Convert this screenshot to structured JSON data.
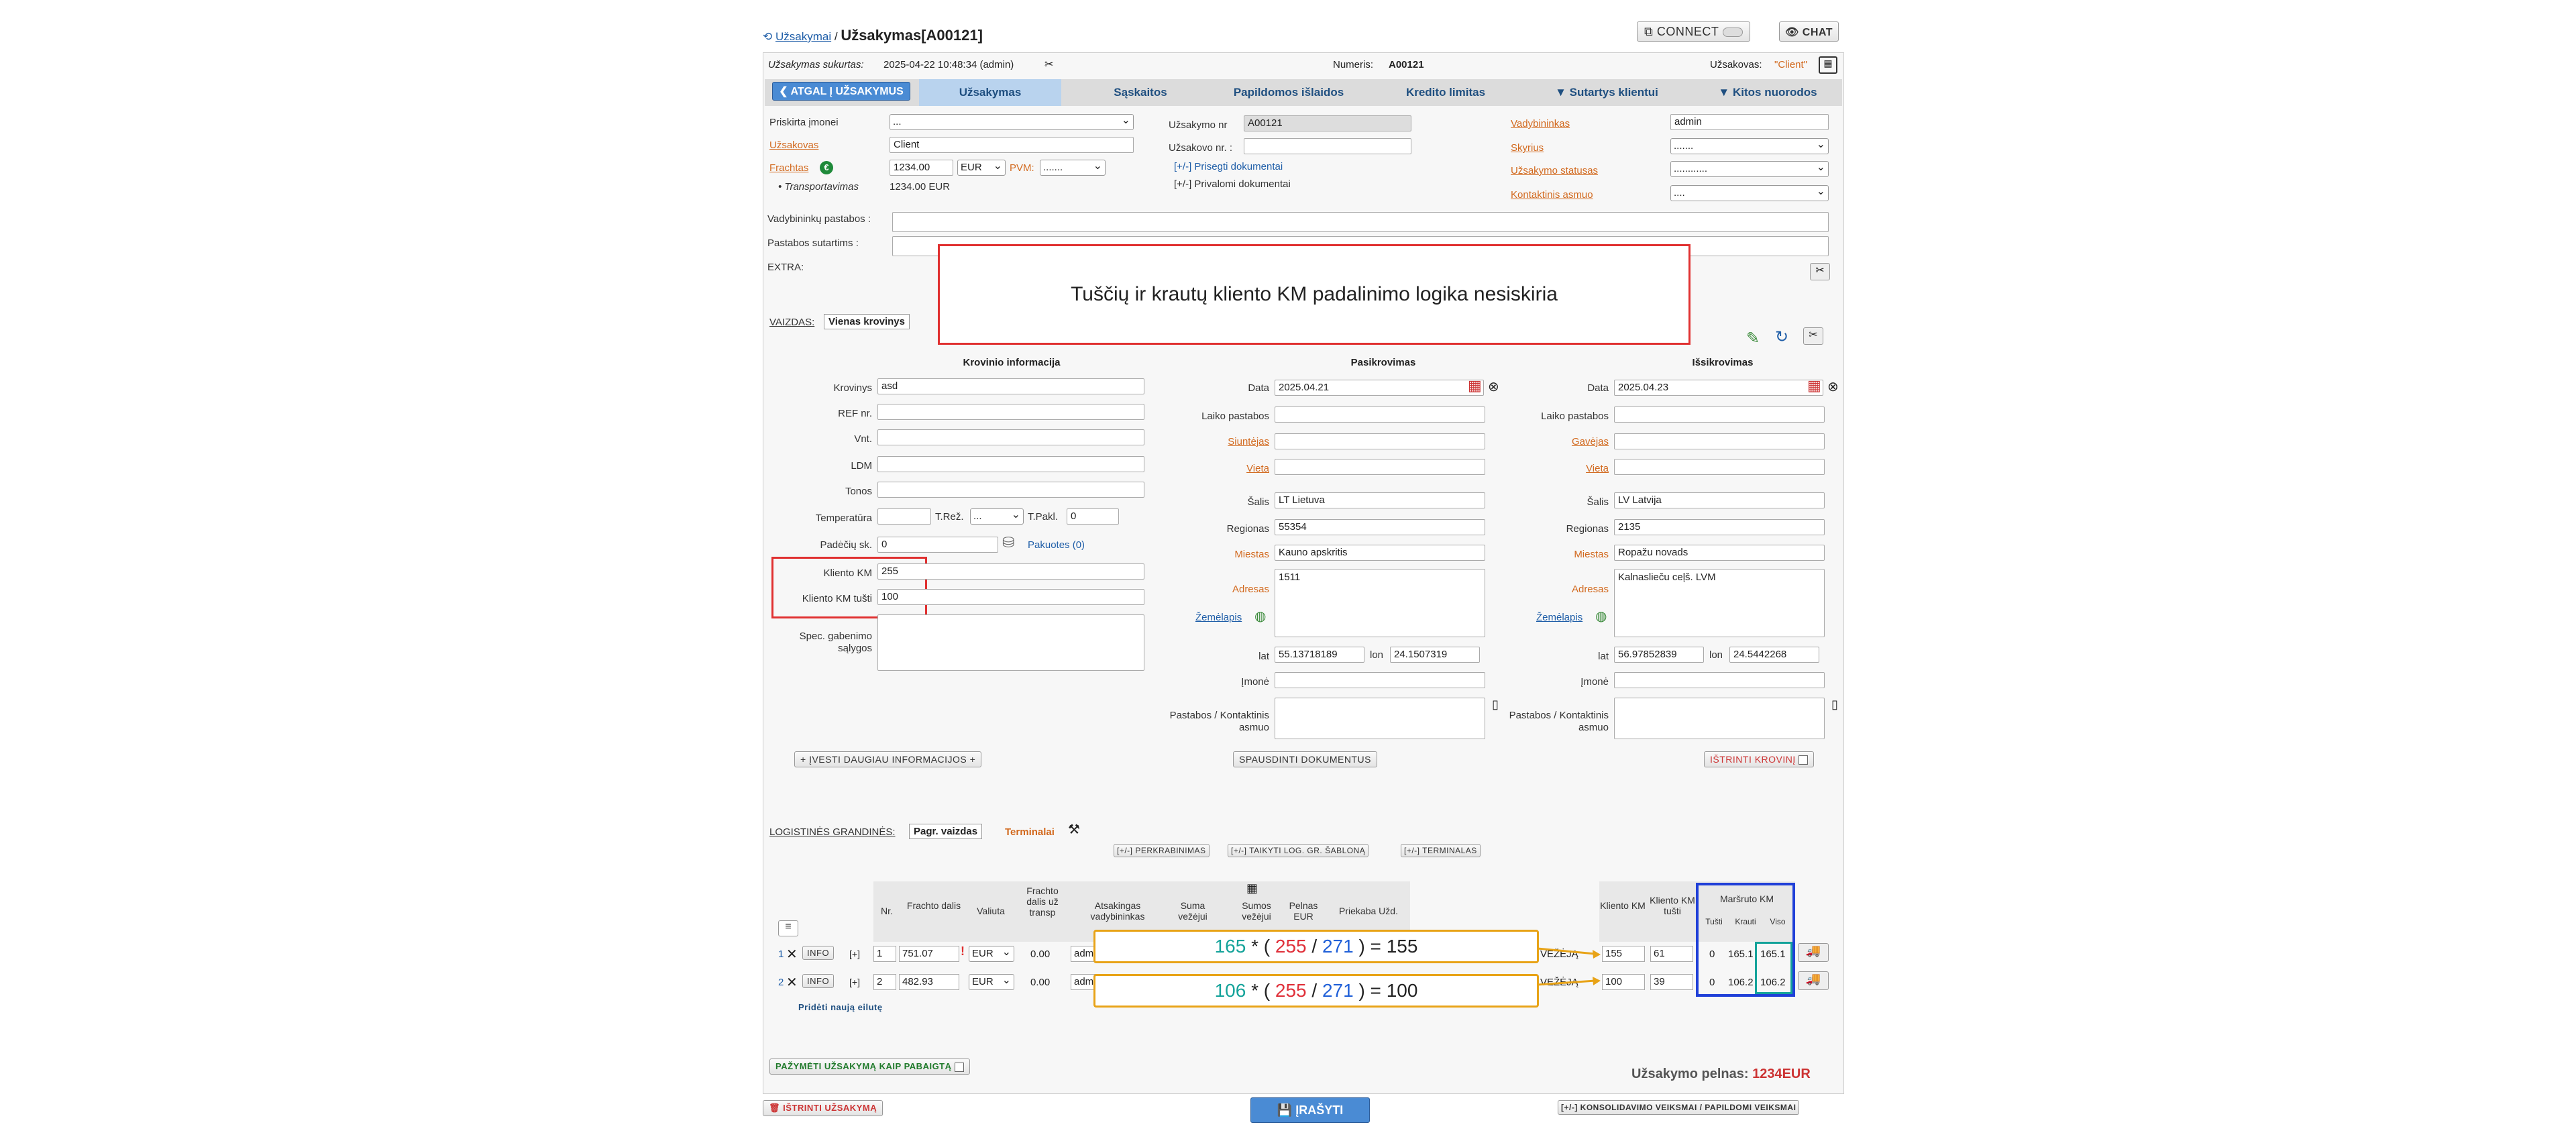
{
  "breadcrumb": {
    "home": "Užsakymai",
    "sep": "/",
    "title": "Užsakymas[A00121]"
  },
  "top_buttons": {
    "connect": "CONNECT",
    "chat": "CHAT"
  },
  "info_bar": {
    "created_label": "Užsakymas sukurtas:",
    "created_value": "2025-04-22 10:48:34 (admin)",
    "number_label": "Numeris:",
    "number_value": "A00121",
    "customer_label": "Užsakovas:",
    "customer_value": "\"Client\""
  },
  "tabs": {
    "back": "❮ ATGAL Į UŽSAKYMUS",
    "order": "Užsakymas",
    "invoices": "Sąskaitos",
    "extra_costs": "Papildomos išlaidos",
    "credit": "Kredito limitas",
    "contracts": "▼ Sutartys klientui",
    "links": "▼ Kitos nuorodos"
  },
  "form": {
    "company_label": "Priskirta įmonei",
    "company_value": "...",
    "customer_label": "Užsakovas",
    "customer_value": "Client",
    "freight_label": "Frachtas",
    "freight_value": "1234.00",
    "currency": "EUR",
    "vat_label": "PVM:",
    "vat_value": ".......",
    "transport_label": "Transportavimas",
    "transport_value": "1234.00 EUR",
    "order_no_label": "Užsakymo nr",
    "order_no_value": "A00121",
    "client_order_label": "Užsakovo nr. :",
    "client_order_value": "",
    "attach_docs": "[+/-] Prisegti dokumentai",
    "private_docs": "[+/-] Privalomi dokumentai",
    "manager_label": "Vadybininkas",
    "manager_value": "admin",
    "dept_label": "Skyrius",
    "dept_value": ".......",
    "status_label": "Užsakymo statusas",
    "status_value": "............",
    "contact_label": "Kontaktinis asmuo",
    "contact_value": "....",
    "mgr_notes_label": "Vadybininkų pastabos :",
    "contract_notes_label": "Pastabos sutartims :",
    "extra_label": "EXTRA:"
  },
  "view": {
    "label": "VAIZDAS:",
    "value": "Vienas krovinys"
  },
  "callout": "Tuščių ir krautų kliento KM padalinimo logika nesiskiria",
  "cargo": {
    "title": "Krovinio informacija",
    "cargo_label": "Krovinys",
    "cargo_value": "asd",
    "ref_label": "REF nr.",
    "units_label": "Vnt.",
    "ldm_label": "LDM",
    "tons_label": "Tonos",
    "temp_label": "Temperatūra",
    "treg_label": "T.Rež.",
    "treg_value": "...",
    "tpakl_label": "T.Pakl.",
    "tpakl_value": "0",
    "pallets_label": "Padėčių sk.",
    "pallets_value": "0",
    "packed": "Pakuotes (0)",
    "km_label": "Kliento KM",
    "km_value": "255",
    "km_empty_label": "Kliento KM tušti",
    "km_empty_value": "100",
    "spec_label": "Spec. gabenimo sąlygos",
    "more_info_btn": "+ ĮVESTI DAUGIAU INFORMACIJOS +"
  },
  "pickup": {
    "title": "Pasikrovimas",
    "date_label": "Data",
    "date_value": "2025.04.21",
    "time_label": "Laiko pastabos",
    "sender_label": "Siuntėjas",
    "place_label": "Vieta",
    "country_label": "Šalis",
    "country_value": "LT Lietuva",
    "region_label": "Regionas",
    "region_value": "55354",
    "city_label": "Miestas",
    "city_value": "Kauno apskritis",
    "address_label": "Adresas",
    "address_value": "1511",
    "map_label": "Žemėlapis",
    "lat_label": "lat",
    "lat_value": "55.13718189",
    "lon_label": "lon",
    "lon_value": "24.1507319",
    "company_label": "Įmonė",
    "notes_label": "Pastabos / Kontaktinis asmuo",
    "print_btn": "SPAUSDINTI DOKUMENTUS"
  },
  "delivery": {
    "title": "Išsikrovimas",
    "date_label": "Data",
    "date_value": "2025.04.23",
    "time_label": "Laiko pastabos",
    "receiver_label": "Gavėjas",
    "place_label": "Vieta",
    "country_label": "Šalis",
    "country_value": "LV Latvija",
    "region_label": "Regionas",
    "region_value": "2135",
    "city_label": "Miestas",
    "city_value": "Ropažu novads",
    "address_label": "Adresas",
    "address_value": "Kalnaslieču ceļš. LVM",
    "map_label": "Žemėlapis",
    "lat_label": "lat",
    "lat_value": "56.97852839",
    "lon_label": "lon",
    "lon_value": "24.5442268",
    "company_label": "Įmonė",
    "notes_label": "Pastabos / Kontaktinis asmuo",
    "delete_btn": "IŠTRINTI KROVINĮ"
  },
  "logistics": {
    "label": "LOGISTINĖS GRANDINĖS:",
    "view": "Pagr. vaizdas",
    "terminals": "Terminalai",
    "reload": "[+/-] PERKRABINIMAS",
    "apply_tpl": "[+/-] TAIKYTI LOG. GR. ŠABLONĄ",
    "terminal": "[+/-] TERMINALAS"
  },
  "table": {
    "headers": [
      "Nr.",
      "Frachto dalis",
      "Valiuta",
      "Frachto dalis už transp",
      "Atsakingas vadybininkas",
      "Suma vežėjui",
      "Sumos vežėjui",
      "Pelnas EUR",
      "Priekaba Užd."
    ],
    "right_headers": [
      "Kliento KM",
      "Kliento KM tušti",
      "Maršruto KM",
      "Tušti",
      "Krauti",
      "Viso"
    ],
    "rows": [
      {
        "idx": "1",
        "nr": "1",
        "fraction": "751.07",
        "currency": "EUR",
        "transp": "0.00",
        "mgr": "adm",
        "carrier": "VEŽĖJĄ",
        "km": "155",
        "km_empty": "61",
        "empty": "0",
        "loaded": "165.1",
        "total": "165.1"
      },
      {
        "idx": "2",
        "nr": "2",
        "fraction": "482.93",
        "currency": "EUR",
        "transp": "0.00",
        "mgr": "adm",
        "carrier": "VEŽĖJĄ",
        "km": "100",
        "km_empty": "39",
        "empty": "0",
        "loaded": "106.2",
        "total": "106.2"
      }
    ],
    "add_row": "Pridėti naują eilutę",
    "info": "INFO",
    "plus": "[+]"
  },
  "formulas": [
    {
      "a": "165",
      "b": "255",
      "c": "271",
      "result": "155"
    },
    {
      "a": "106",
      "b": "255",
      "c": "271",
      "result": "100"
    }
  ],
  "formula_tokens": {
    "mul": "*",
    "open": "(",
    "slash": "/",
    "close": ")",
    "eq": "="
  },
  "complete_btn": "PAŽYMĖTI UŽSAKYMĄ KAIP PABAIGTĄ",
  "profit_label": "Užsakymo pelnas:",
  "profit_value": "1234EUR",
  "delete_order": "IŠTRINTI UŽSAKYMĄ",
  "save": "ĮRAŠYTI",
  "consolidation": "[+/-] KONSOLIDAVIMO VEIKSMAI / PAPILDOMI VEIKSMAI",
  "colors": {
    "formula_a": "#14a39a",
    "formula_b": "#e0303a",
    "formula_c": "#2060d8",
    "accent_blue": "#1f5ea8",
    "label_orange": "#d2691e"
  }
}
